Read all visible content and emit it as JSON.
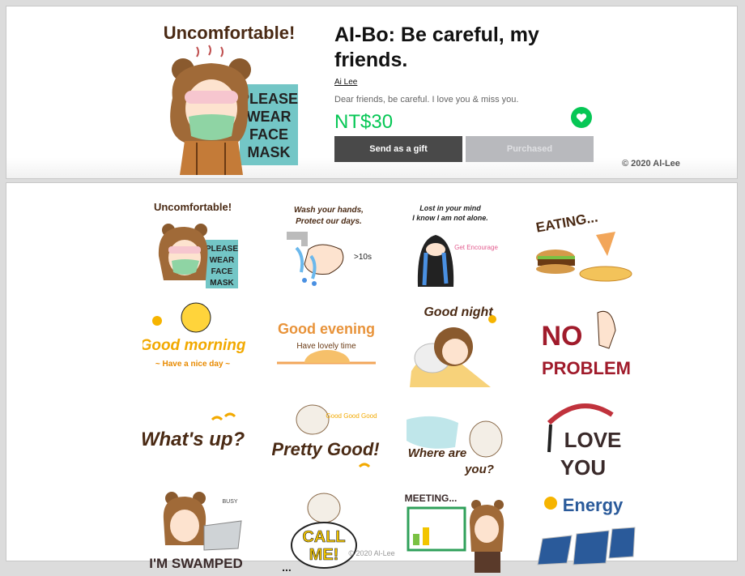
{
  "sticker": {
    "title": "AI-Bo: Be careful, my friends.",
    "author": "Ai Lee",
    "description": "Dear friends, be careful. I love you & miss you.",
    "price": "NT$30",
    "gift_label": "Send as a gift",
    "purchased_label": "Purchased",
    "copyright": "© 2020 Al-Lee",
    "accent": "#06c755",
    "main_caption": "Uncomfortable!",
    "main_sign": [
      "PLEASE",
      "WEAR",
      "FACE",
      "MASK"
    ]
  },
  "stickers": [
    {
      "caption": "Uncomfortable!",
      "sign": [
        "PLEASE",
        "WEAR",
        "FACE",
        "MASK"
      ]
    },
    {
      "caption": "Wash your hands,",
      "caption2": "Protect our days.",
      "extra": ">10s"
    },
    {
      "caption": "Lost in your mind",
      "caption2": "I know I am not alone.",
      "extra": "Get Encourage"
    },
    {
      "caption": "EATING..."
    },
    {
      "caption": "Good morning",
      "caption2": "~ Have a nice day ~"
    },
    {
      "caption": "Good evening",
      "caption2": "Have lovely time"
    },
    {
      "caption": "Good night"
    },
    {
      "caption": "NO",
      "caption2": "PROBLEM"
    },
    {
      "caption": "What's up?"
    },
    {
      "caption": "Pretty Good!",
      "caption2": "Good Good Good"
    },
    {
      "caption": "Where are",
      "caption2": "you?"
    },
    {
      "caption": "LOVE",
      "caption2": "YOU"
    },
    {
      "caption": "I'M SWAMPED",
      "caption2": "BUSY"
    },
    {
      "caption": "CALL",
      "caption2": "ME!",
      "extra": "..."
    },
    {
      "caption": "MEETING..."
    },
    {
      "caption": "Energy"
    }
  ],
  "footer": {
    "copyright": "© 2020 Al-Lee"
  }
}
